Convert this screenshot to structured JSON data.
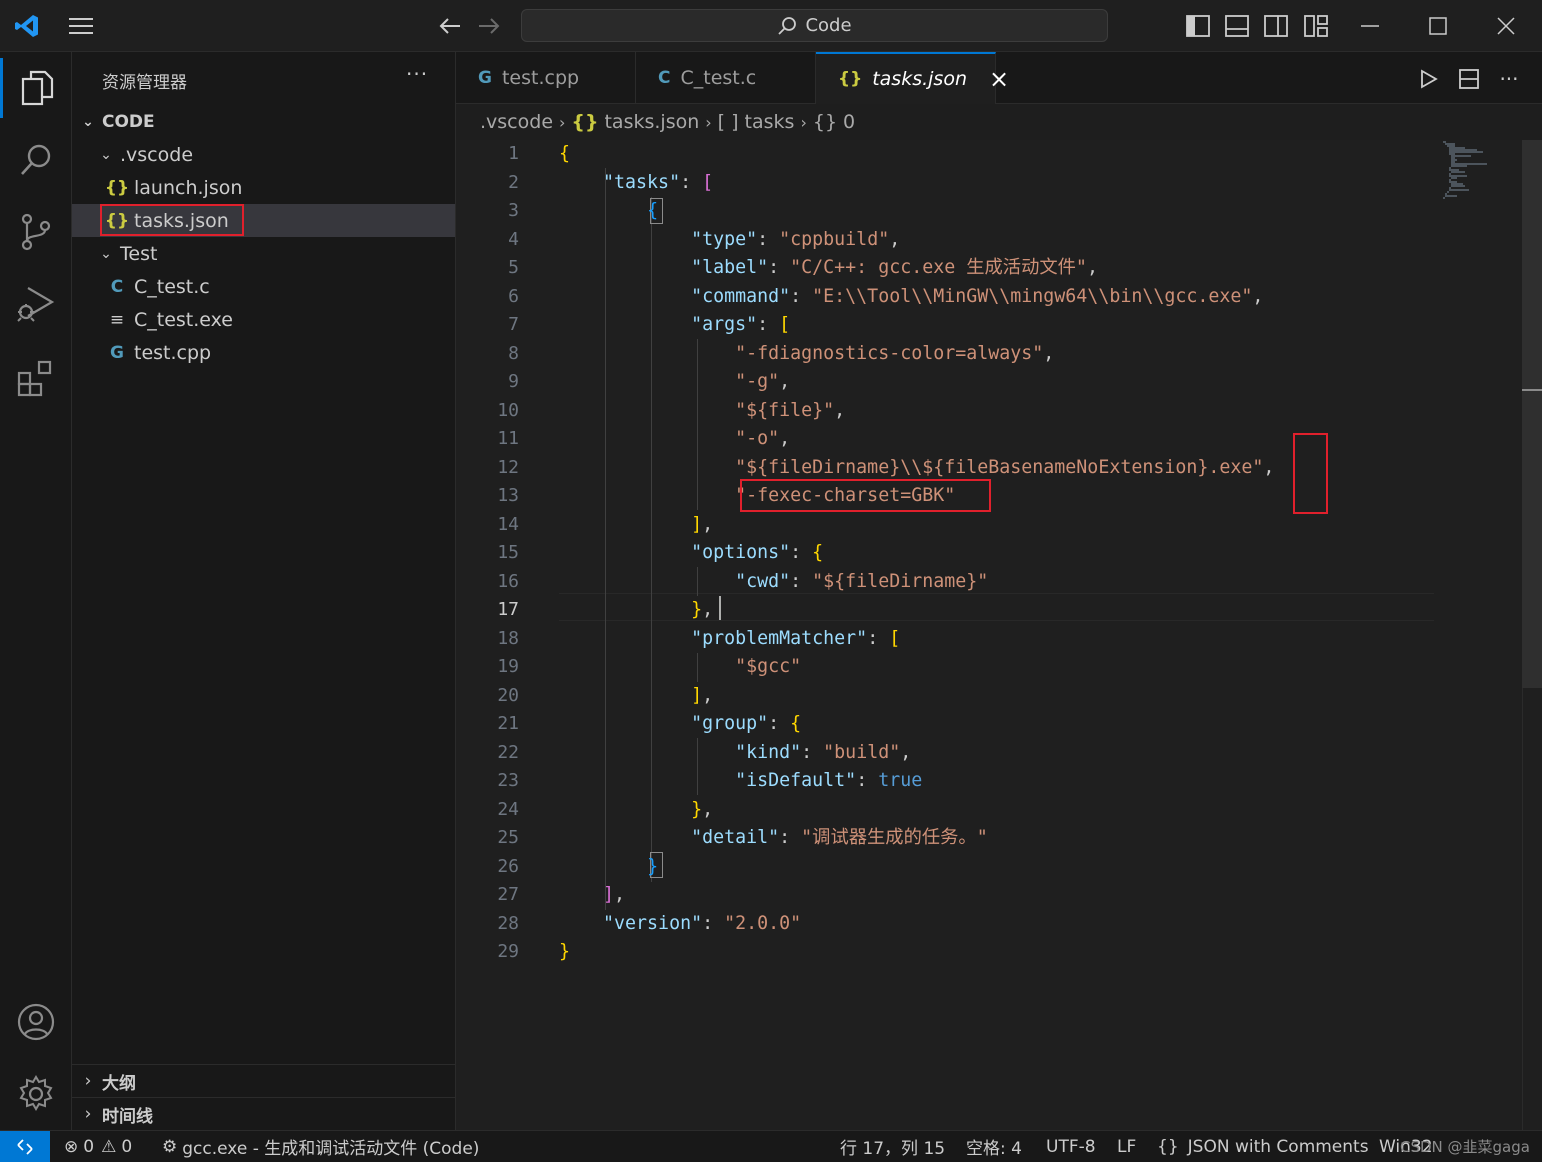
{
  "titlebar": {
    "search_text": "Code"
  },
  "sidebar": {
    "title": "资源管理器",
    "more": "···",
    "root_label": "CODE",
    "tree": {
      "vscode_folder": ".vscode",
      "launch_json": "launch.json",
      "tasks_json": "tasks.json",
      "test_folder": "Test",
      "c_test_c": "C_test.c",
      "c_test_exe": "C_test.exe",
      "test_cpp": "test.cpp"
    },
    "outline_label": "大纲",
    "timeline_label": "时间线"
  },
  "tabs": [
    {
      "label": "test.cpp",
      "icon": "cpp-icon"
    },
    {
      "label": "C_test.c",
      "icon": "c-icon"
    },
    {
      "label": "tasks.json",
      "icon": "json-icon",
      "active": true
    }
  ],
  "tab_close": "×",
  "breadcrumb": {
    "seg1": ".vscode",
    "seg2_icon": "{}",
    "seg2": "tasks.json",
    "seg3_icon": "[ ]",
    "seg3": "tasks",
    "seg4_icon": "{}",
    "seg4": "0"
  },
  "editor": {
    "current_line": 17,
    "lines": [
      {
        "n": "1",
        "tokens": [
          {
            "t": "{",
            "c": "b1"
          }
        ]
      },
      {
        "n": "2",
        "tokens": [
          {
            "t": "    "
          },
          {
            "t": "\"tasks\"",
            "c": "k"
          },
          {
            "t": ": "
          },
          {
            "t": "[",
            "c": "b2"
          }
        ]
      },
      {
        "n": "3",
        "tokens": [
          {
            "t": "        "
          },
          {
            "t": "{",
            "c": "b3"
          }
        ]
      },
      {
        "n": "4",
        "tokens": [
          {
            "t": "            "
          },
          {
            "t": "\"type\"",
            "c": "k"
          },
          {
            "t": ": "
          },
          {
            "t": "\"cppbuild\"",
            "c": "s"
          },
          {
            "t": ","
          }
        ]
      },
      {
        "n": "5",
        "tokens": [
          {
            "t": "            "
          },
          {
            "t": "\"label\"",
            "c": "k"
          },
          {
            "t": ": "
          },
          {
            "t": "\"C/C++: gcc.exe 生成活动文件\"",
            "c": "s"
          },
          {
            "t": ","
          }
        ]
      },
      {
        "n": "6",
        "tokens": [
          {
            "t": "            "
          },
          {
            "t": "\"command\"",
            "c": "k"
          },
          {
            "t": ": "
          },
          {
            "t": "\"E:\\\\Tool\\\\MinGW\\\\mingw64\\\\bin\\\\gcc.exe\"",
            "c": "s"
          },
          {
            "t": ","
          }
        ]
      },
      {
        "n": "7",
        "tokens": [
          {
            "t": "            "
          },
          {
            "t": "\"args\"",
            "c": "k"
          },
          {
            "t": ": "
          },
          {
            "t": "[",
            "c": "b1"
          }
        ]
      },
      {
        "n": "8",
        "tokens": [
          {
            "t": "                "
          },
          {
            "t": "\"-fdiagnostics-color=always\"",
            "c": "s"
          },
          {
            "t": ","
          }
        ]
      },
      {
        "n": "9",
        "tokens": [
          {
            "t": "                "
          },
          {
            "t": "\"-g\"",
            "c": "s"
          },
          {
            "t": ","
          }
        ]
      },
      {
        "n": "10",
        "tokens": [
          {
            "t": "                "
          },
          {
            "t": "\"${file}\"",
            "c": "s"
          },
          {
            "t": ","
          }
        ]
      },
      {
        "n": "11",
        "tokens": [
          {
            "t": "                "
          },
          {
            "t": "\"-o\"",
            "c": "s"
          },
          {
            "t": ","
          }
        ]
      },
      {
        "n": "12",
        "tokens": [
          {
            "t": "                "
          },
          {
            "t": "\"${fileDirname}\\\\${fileBasenameNoExtension}.exe\"",
            "c": "s"
          },
          {
            "t": ","
          }
        ]
      },
      {
        "n": "13",
        "tokens": [
          {
            "t": "                "
          },
          {
            "t": "\"-fexec-charset=GBK\"",
            "c": "s"
          }
        ]
      },
      {
        "n": "14",
        "tokens": [
          {
            "t": "            "
          },
          {
            "t": "]",
            "c": "b1"
          },
          {
            "t": ","
          }
        ]
      },
      {
        "n": "15",
        "tokens": [
          {
            "t": "            "
          },
          {
            "t": "\"options\"",
            "c": "k"
          },
          {
            "t": ": "
          },
          {
            "t": "{",
            "c": "b1"
          }
        ]
      },
      {
        "n": "16",
        "tokens": [
          {
            "t": "                "
          },
          {
            "t": "\"cwd\"",
            "c": "k"
          },
          {
            "t": ": "
          },
          {
            "t": "\"${fileDirname}\"",
            "c": "s"
          }
        ]
      },
      {
        "n": "17",
        "tokens": [
          {
            "t": "            "
          },
          {
            "t": "}",
            "c": "b1"
          },
          {
            "t": ","
          }
        ]
      },
      {
        "n": "18",
        "tokens": [
          {
            "t": "            "
          },
          {
            "t": "\"problemMatcher\"",
            "c": "k"
          },
          {
            "t": ": "
          },
          {
            "t": "[",
            "c": "b1"
          }
        ]
      },
      {
        "n": "19",
        "tokens": [
          {
            "t": "                "
          },
          {
            "t": "\"$gcc\"",
            "c": "s"
          }
        ]
      },
      {
        "n": "20",
        "tokens": [
          {
            "t": "            "
          },
          {
            "t": "]",
            "c": "b1"
          },
          {
            "t": ","
          }
        ]
      },
      {
        "n": "21",
        "tokens": [
          {
            "t": "            "
          },
          {
            "t": "\"group\"",
            "c": "k"
          },
          {
            "t": ": "
          },
          {
            "t": "{",
            "c": "b1"
          }
        ]
      },
      {
        "n": "22",
        "tokens": [
          {
            "t": "                "
          },
          {
            "t": "\"kind\"",
            "c": "k"
          },
          {
            "t": ": "
          },
          {
            "t": "\"build\"",
            "c": "s"
          },
          {
            "t": ","
          }
        ]
      },
      {
        "n": "23",
        "tokens": [
          {
            "t": "                "
          },
          {
            "t": "\"isDefault\"",
            "c": "k"
          },
          {
            "t": ": "
          },
          {
            "t": "true",
            "c": "kw"
          }
        ]
      },
      {
        "n": "24",
        "tokens": [
          {
            "t": "            "
          },
          {
            "t": "}",
            "c": "b1"
          },
          {
            "t": ","
          }
        ]
      },
      {
        "n": "25",
        "tokens": [
          {
            "t": "            "
          },
          {
            "t": "\"detail\"",
            "c": "k"
          },
          {
            "t": ": "
          },
          {
            "t": "\"调试器生成的任务。\"",
            "c": "s"
          }
        ]
      },
      {
        "n": "26",
        "tokens": [
          {
            "t": "        "
          },
          {
            "t": "}",
            "c": "b3"
          }
        ]
      },
      {
        "n": "27",
        "tokens": [
          {
            "t": "    "
          },
          {
            "t": "]",
            "c": "b2"
          },
          {
            "t": ","
          }
        ]
      },
      {
        "n": "28",
        "tokens": [
          {
            "t": "    "
          },
          {
            "t": "\"version\"",
            "c": "k"
          },
          {
            "t": ": "
          },
          {
            "t": "\"2.0.0\"",
            "c": "s"
          }
        ]
      },
      {
        "n": "29",
        "tokens": [
          {
            "t": "}",
            "c": "b1"
          }
        ]
      }
    ]
  },
  "statusbar": {
    "errors": "0",
    "warnings": "0",
    "task": "gcc.exe - 生成和调试活动文件 (Code)",
    "position": "行 17，列 15",
    "spaces": "空格: 4",
    "encoding": "UTF-8",
    "eol": "LF",
    "lang_icon": "{}",
    "language": "JSON with Comments",
    "platform": "Win32",
    "watermark": "CSDN @韭菜gaga"
  },
  "colors": {
    "accent": "#0078d4",
    "highlight_box": "#e0202c",
    "json_icon": "#cbcb41",
    "c_icon": "#519aba"
  }
}
